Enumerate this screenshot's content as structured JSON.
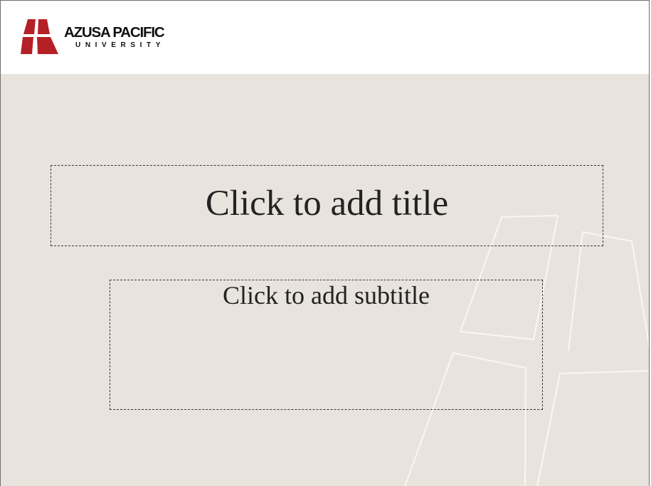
{
  "logo": {
    "line1": "AZUSA PACIFIC",
    "line2": "UNIVERSITY",
    "brand_red": "#b52027",
    "icon": "apu-shield-logo-icon"
  },
  "slide": {
    "background": "#e8e3dd",
    "title_placeholder": "Click to add title",
    "subtitle_placeholder": "Click to add subtitle"
  }
}
